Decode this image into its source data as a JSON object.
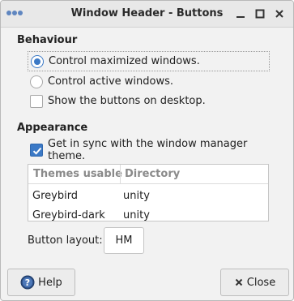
{
  "window": {
    "title": "Window Header - Buttons",
    "controls": [
      "minimize",
      "maximize",
      "close"
    ]
  },
  "behaviour": {
    "heading": "Behaviour",
    "options": [
      {
        "type": "radio",
        "label": "Control maximized windows.",
        "checked": true
      },
      {
        "type": "radio",
        "label": "Control active windows.",
        "checked": false
      },
      {
        "type": "checkbox",
        "label": "Show the buttons on desktop.",
        "checked": false
      }
    ]
  },
  "appearance": {
    "heading": "Appearance",
    "sync_label": "Get in sync with the window manager theme.",
    "sync_checked": true,
    "table": {
      "columns": [
        "Themes usable",
        "Directory"
      ],
      "rows": [
        [
          "Greybird",
          "unity"
        ],
        [
          "Greybird-dark",
          "unity"
        ]
      ]
    },
    "button_layout_label": "Button layout:",
    "button_layout_value": "HM"
  },
  "footer": {
    "help_label": "Help",
    "close_label": "Close"
  },
  "colors": {
    "accent": "#3b79c6"
  }
}
